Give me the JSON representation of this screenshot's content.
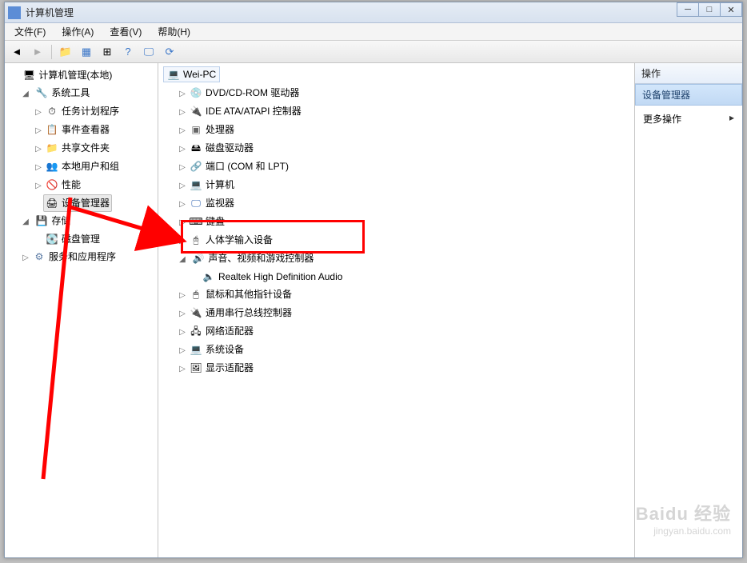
{
  "titlebar": {
    "title": "计算机管理"
  },
  "menubar": {
    "file": "文件(F)",
    "action": "操作(A)",
    "view": "查看(V)",
    "help": "帮助(H)"
  },
  "left_tree": {
    "root": "计算机管理(本地)",
    "system_tools": "系统工具",
    "task_scheduler": "任务计划程序",
    "event_viewer": "事件查看器",
    "shared_folders": "共享文件夹",
    "local_users": "本地用户和组",
    "performance": "性能",
    "device_manager": "设备管理器",
    "storage": "存储",
    "disk_management": "磁盘管理",
    "services_apps": "服务和应用程序"
  },
  "middle_tree": {
    "root": "Wei-PC",
    "dvd": "DVD/CD-ROM 驱动器",
    "ide": "IDE ATA/ATAPI 控制器",
    "cpu": "处理器",
    "disk_drives": "磁盘驱动器",
    "ports": "端口 (COM 和 LPT)",
    "computers": "计算机",
    "monitors": "监视器",
    "keyboards": "键盘",
    "hid": "人体学输入设备",
    "audio_controllers": "声音、视频和游戏控制器",
    "realtek": "Realtek High Definition Audio",
    "mouse": "鼠标和其他指针设备",
    "usb": "通用串行总线控制器",
    "network": "网络适配器",
    "system_devices": "系统设备",
    "display_adapters": "显示适配器"
  },
  "actions": {
    "header": "操作",
    "section": "设备管理器",
    "more": "更多操作"
  },
  "watermark": {
    "line1": "Baidu 经验",
    "line2": "jingyan.baidu.com"
  }
}
